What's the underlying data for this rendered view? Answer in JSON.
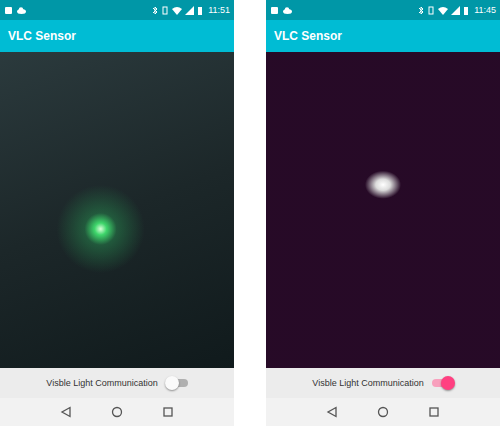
{
  "screens": [
    {
      "status_bar": {
        "time": "11:51"
      },
      "app_bar": {
        "title": "VLC Sensor"
      },
      "control": {
        "label": "Visble Light Communication",
        "on": false
      }
    },
    {
      "status_bar": {
        "time": "11:45"
      },
      "app_bar": {
        "title": "VLC Sensor"
      },
      "control": {
        "label": "Visble Light Communication",
        "on": true
      }
    }
  ]
}
